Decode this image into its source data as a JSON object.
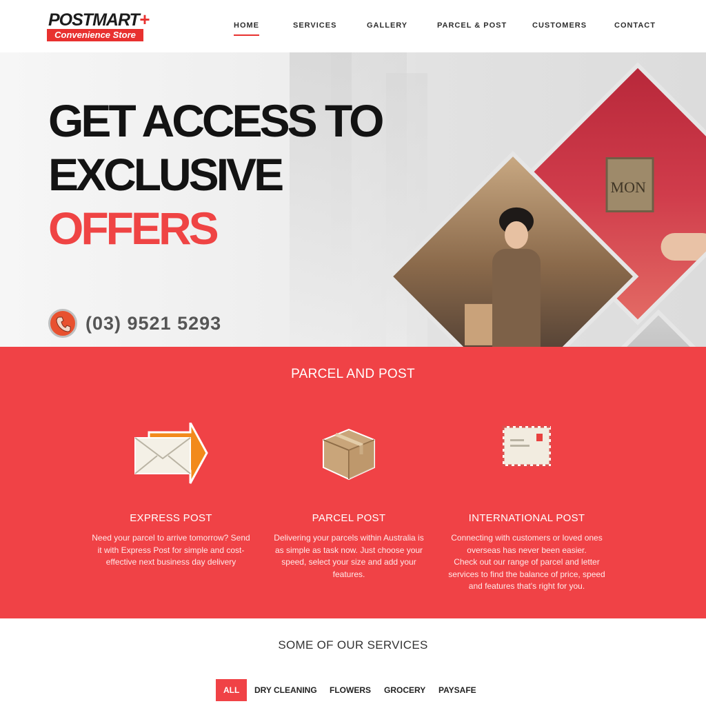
{
  "header": {
    "logo": {
      "top": "POSTMART",
      "plus": "+",
      "bottom": "Convenience Store"
    },
    "nav": [
      {
        "label": "HOME",
        "active": true
      },
      {
        "label": "SERVICES"
      },
      {
        "label": "GALLERY"
      },
      {
        "label": "PARCEL & POST"
      },
      {
        "label": "CUSTOMERS"
      },
      {
        "label": "CONTACT"
      }
    ]
  },
  "hero": {
    "title_line1": "GET ACCESS TO",
    "title_line2": "EXCLUSIVE",
    "title_line3": "OFFERS",
    "phone": "(03) 9521 5293",
    "mailbox_text": "MON"
  },
  "parcel": {
    "heading": "PARCEL AND POST",
    "cards": [
      {
        "title": "EXPRESS POST",
        "icon": "express-envelope-icon",
        "lines": [
          "Need your parcel to arrive tomorrow? Send",
          "it with Express Post for simple and cost-",
          "effective next business day delivery"
        ]
      },
      {
        "title": "PARCEL POST",
        "icon": "parcel-box-icon",
        "lines": [
          "Delivering your parcels within Australia is",
          "as simple as task now. Just choose your",
          "speed, select your size and add your",
          "features."
        ]
      },
      {
        "title": "INTERNATIONAL POST",
        "icon": "airmail-envelope-icon",
        "lines": [
          "Connecting with customers or loved ones",
          "overseas has never been easier.",
          "Check out our range of parcel and letter",
          "services to find the balance of price, speed",
          "and features that's right for you."
        ]
      }
    ]
  },
  "services": {
    "heading": "SOME OF OUR SERVICES",
    "tabs": [
      {
        "label": "ALL",
        "active": true
      },
      {
        "label": "DRY CLEANING"
      },
      {
        "label": "FLOWERS"
      },
      {
        "label": "GROCERY"
      },
      {
        "label": "PAYSAFE"
      }
    ]
  },
  "colors": {
    "accent": "#f04246",
    "dark": "#131313",
    "phone_icon": "#e8512f"
  }
}
